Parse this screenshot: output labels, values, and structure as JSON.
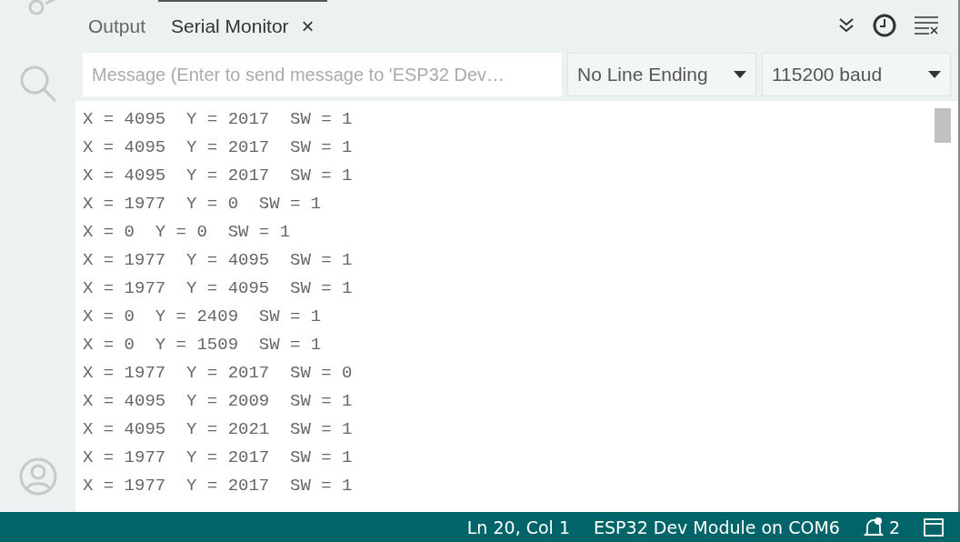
{
  "tabs": [
    {
      "label": "Output",
      "selected": false
    },
    {
      "label": "Serial Monitor",
      "selected": true,
      "close": "×"
    }
  ],
  "message_field": {
    "placeholder": "Message (Enter to send message to 'ESP32 Dev…"
  },
  "line_ending": {
    "value": "No Line Ending"
  },
  "baud_rate": {
    "value": "115200 baud"
  },
  "output_lines": [
    "X = 4095  Y = 2017  SW = 1",
    "X = 4095  Y = 2017  SW = 1",
    "X = 4095  Y = 2017  SW = 1",
    "X = 1977  Y = 0  SW = 1",
    "X = 0  Y = 0  SW = 1",
    "X = 1977  Y = 4095  SW = 1",
    "X = 1977  Y = 4095  SW = 1",
    "X = 0  Y = 2409  SW = 1",
    "X = 0  Y = 1509  SW = 1",
    "X = 1977  Y = 2017  SW = 0",
    "X = 4095  Y = 2009  SW = 1",
    "X = 4095  Y = 2021  SW = 1",
    "X = 1977  Y = 2017  SW = 1",
    "X = 1977  Y = 2017  SW = 1"
  ],
  "status_bar": {
    "position": "Ln 20, Col 1",
    "board": "ESP32 Dev Module on COM6",
    "notifications": "2"
  }
}
